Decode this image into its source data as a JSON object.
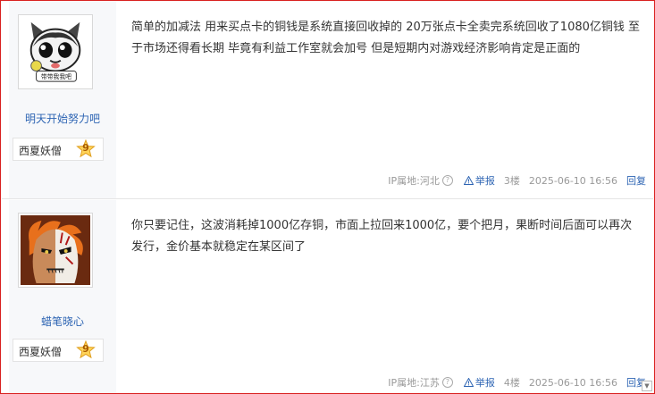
{
  "posts": [
    {
      "username": "明天开始努力吧",
      "avatar_caption": "带带我我吧",
      "badge": {
        "name": "西夏妖僧",
        "level": "9"
      },
      "content": "简单的加减法 用来买点卡的铜钱是系统直接回收掉的 20万张点卡全卖完系统回收了1080亿铜钱 至于市场还得看长期 毕竟有利益工作室就会加号 但是短期内对游戏经济影响肯定是正面的",
      "ip": "IP属地:河北",
      "report": "举报",
      "floor": "3楼",
      "time": "2025-06-10 16:56",
      "reply": "回复"
    },
    {
      "username": "蜡笔晓心",
      "badge": {
        "name": "西夏妖僧",
        "level": "9"
      },
      "content": "你只要记住，这波消耗掉1000亿存铜，市面上拉回来1000亿，要个把月，果断时间后面可以再次发行，金价基本就稳定在某区间了",
      "ip": "IP属地:江苏",
      "report": "举报",
      "floor": "4楼",
      "time": "2025-06-10 16:56",
      "reply": "回复"
    }
  ],
  "colors": {
    "frame_border": "#d9201f",
    "link_blue": "#2d64b3",
    "sidebar_bg": "#f7f8fa",
    "meta_gray": "#999999"
  },
  "icons": [
    "question-icon",
    "warning-icon",
    "level-star-icon",
    "scroll-down-icon"
  ]
}
